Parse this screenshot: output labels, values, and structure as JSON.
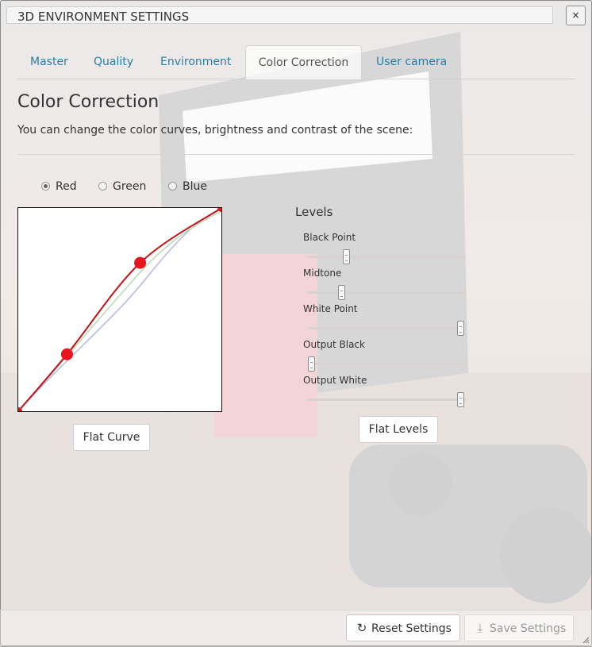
{
  "window": {
    "title": "3D ENVIRONMENT SETTINGS",
    "close_label": "×"
  },
  "tabs": [
    {
      "label": "Master"
    },
    {
      "label": "Quality"
    },
    {
      "label": "Environment"
    },
    {
      "label": "Color Correction",
      "active": true
    },
    {
      "label": "User camera"
    }
  ],
  "section": {
    "title": "Color Correction",
    "description": "You can change the color curves, brightness and contrast of the scene:"
  },
  "channels": [
    {
      "label": "Red",
      "selected": true
    },
    {
      "label": "Green",
      "selected": false
    },
    {
      "label": "Blue",
      "selected": false
    }
  ],
  "curve": {
    "selected_channel": "Red",
    "colors": {
      "red": "#c0141a",
      "green": "#b9dbb4",
      "blue": "#b2b8e0",
      "point": "#e8141e"
    },
    "red_points": [
      [
        0,
        0
      ],
      [
        0.24,
        0.28
      ],
      [
        0.6,
        0.73
      ],
      [
        1.0,
        1.0
      ]
    ]
  },
  "buttons": {
    "flat_curve": "Flat Curve",
    "flat_levels": "Flat Levels"
  },
  "levels": {
    "title": "Levels",
    "sliders": [
      {
        "label": "Black Point",
        "value": 0.25
      },
      {
        "label": "Midtone",
        "value": 0.22
      },
      {
        "label": "White Point",
        "value": 0.97
      },
      {
        "label": "Output Black",
        "value": 0.03
      },
      {
        "label": "Output White",
        "value": 0.97
      }
    ]
  },
  "footer": {
    "reset_label": "Reset Settings",
    "reset_icon": "refresh-icon",
    "save_label": "Save Settings",
    "save_icon": "download-icon",
    "save_enabled": false
  }
}
